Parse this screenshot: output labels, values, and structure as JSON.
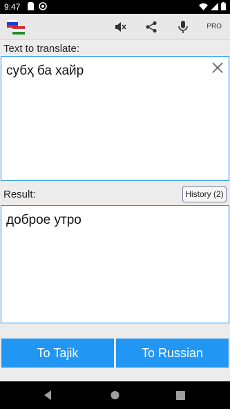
{
  "status_bar": {
    "time": "9:47",
    "icons": [
      "sim-card-icon",
      "at-sign-icon",
      "wifi-icon",
      "signal-icon",
      "battery-icon"
    ]
  },
  "app_bar": {
    "icons": [
      "flag-icon",
      "mute-icon",
      "share-icon",
      "microphone-icon"
    ],
    "pro_label": "PRO"
  },
  "input": {
    "label": "Text to translate:",
    "value": "субҳ ба хайр"
  },
  "result": {
    "label": "Result:",
    "value": "доброе утро",
    "history_label": "History (2)"
  },
  "buttons": {
    "to_tajik": "To Tajik",
    "to_russian": "To Russian"
  },
  "nav_bar": {
    "icons": [
      "back-icon",
      "home-icon",
      "recents-icon"
    ]
  },
  "colors": {
    "accent": "#2196f3",
    "app_bar": "#e8e8e8",
    "background": "#ececec"
  }
}
